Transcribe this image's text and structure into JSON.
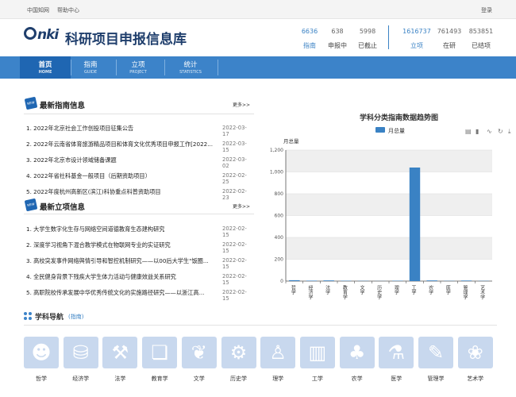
{
  "topbar": {
    "link1": "中国知网",
    "link2": "帮助中心",
    "login": "登录"
  },
  "logo": {
    "mark": "nki",
    "title": "科研项目申报信息库"
  },
  "stats": [
    {
      "value": "6636",
      "label": "指南",
      "color": "#3a82c4"
    },
    {
      "value": "638",
      "label": "申报中"
    },
    {
      "value": "5998",
      "label": "已截止"
    },
    {
      "value": "1616737",
      "label": "立项",
      "color": "#3a82c4"
    },
    {
      "value": "761493",
      "label": "在研"
    },
    {
      "value": "853851",
      "label": "已结项"
    }
  ],
  "nav": [
    {
      "label": "首页",
      "sub": "HOME",
      "active": true
    },
    {
      "label": "指南",
      "sub": "GUIDE"
    },
    {
      "label": "立项",
      "sub": "PROJECT"
    },
    {
      "label": "统计",
      "sub": "STATISTICS"
    }
  ],
  "guide": {
    "title": "最新指南信息",
    "more": "更多>>",
    "items": [
      {
        "text": "1. 2022年北京社会工作创投项目征集公告",
        "date": "2022-03-17"
      },
      {
        "text": "2. 2022年云南省体育旅游精品项目和体育文化优秀项目申报工作[2022...",
        "date": "2022-03-15"
      },
      {
        "text": "3. 2022年北京市设计领域储备课题",
        "date": "2022-03-02"
      },
      {
        "text": "4. 2022年省社科基金一般项目（后期资助项目）",
        "date": "2022-02-25"
      },
      {
        "text": "5. 2022年度杭州高新区(滨江)科协重点科普资助项目",
        "date": "2022-02-23"
      }
    ]
  },
  "project": {
    "title": "最新立项信息",
    "more": "更多>>",
    "items": [
      {
        "text": "1. 大学生数字化生存与网络空间道德教育生态建构研究",
        "date": "2022-02-15"
      },
      {
        "text": "2. 深度学习视角下混合教学模式在物联网专业的实证研究",
        "date": "2022-02-15"
      },
      {
        "text": "3. 高校突发事件网络舆情引导和智控机制研究——以00后大学生\"饭圈...",
        "date": "2022-02-15"
      },
      {
        "text": "4. 全民健身背景下残疾大学生体力活动与健康效益关系研究",
        "date": "2022-02-15"
      },
      {
        "text": "5. 高职院校传承发展中华优秀传统文化的实施路径研究——以浙江高...",
        "date": "2022-02-15"
      }
    ]
  },
  "chart_data": {
    "type": "bar",
    "title": "学科分类指南数据趋势图",
    "legend": "月总量",
    "ylabel": "月总量",
    "ylim": [
      0,
      1200
    ],
    "yticks": [
      "0",
      "200",
      "400",
      "600",
      "800",
      "1,000",
      "1,200"
    ],
    "categories": [
      "哲学",
      "经济学",
      "法学",
      "教育学",
      "文学",
      "历史学",
      "理学",
      "工学",
      "农学",
      "医学",
      "管理学",
      "艺术学"
    ],
    "values": [
      8,
      4,
      6,
      3,
      2,
      1,
      3,
      1040,
      6,
      2,
      5,
      2
    ],
    "color": "#3a82c4",
    "grid": true,
    "legend_position": "top"
  },
  "subjects": {
    "title": "学科导航",
    "sub": "(指南)",
    "items": [
      {
        "label": "哲学",
        "icon": "head-icon"
      },
      {
        "label": "经济学",
        "icon": "coins-icon"
      },
      {
        "label": "法学",
        "icon": "gavel-icon"
      },
      {
        "label": "教育学",
        "icon": "book-icon"
      },
      {
        "label": "文学",
        "icon": "wheat-icon"
      },
      {
        "label": "历史学",
        "icon": "gears-icon"
      },
      {
        "label": "理学",
        "icon": "person-icon"
      },
      {
        "label": "工学",
        "icon": "factory-icon"
      },
      {
        "label": "农学",
        "icon": "sprout-icon"
      },
      {
        "label": "医学",
        "icon": "flask-icon"
      },
      {
        "label": "管理学",
        "icon": "pen-icon"
      },
      {
        "label": "艺术学",
        "icon": "palette-icon"
      }
    ]
  }
}
